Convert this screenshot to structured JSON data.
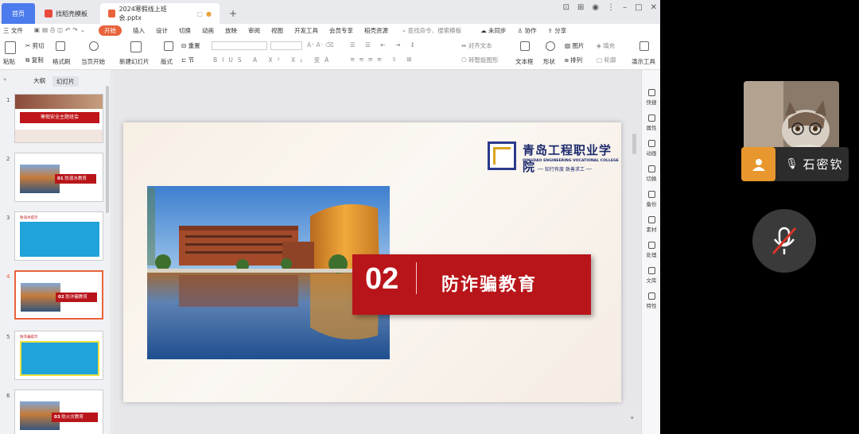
{
  "tabs": {
    "home": "首页",
    "template": "找稻壳模板",
    "document": "2024寒假线上班会.pptx"
  },
  "menu": {
    "file": "三 文件",
    "items": [
      "开始",
      "插入",
      "设计",
      "切换",
      "动画",
      "放映",
      "审阅",
      "视图",
      "开发工具",
      "会员专享",
      "稻壳资源"
    ],
    "search": "查找命令、搜索模板",
    "sync": "未同步",
    "collab": "协作",
    "share": "分享"
  },
  "ribbon": {
    "paste": "粘贴",
    "cut": "剪切",
    "copy": "复制",
    "format_painter": "格式刷",
    "play_from_current": "当页开始",
    "new_slide": "新建幻灯片",
    "layout": "版式",
    "section": "节",
    "reset": "重置",
    "align_text": "对齐文本",
    "smart_shape": "转智能图形",
    "textbox": "文本框",
    "shape": "形状",
    "picture": "图片",
    "fill": "填充",
    "arrange": "排列",
    "outline": "轮廓",
    "present_tools": "演示工具"
  },
  "left_pane": {
    "outline_tab": "大纲",
    "slides_tab": "幻灯片",
    "slides": [
      {
        "num": "1",
        "title": "寒假安全主题班会"
      },
      {
        "num": "2",
        "badge": "01",
        "label": "防溺水教育"
      },
      {
        "num": "3",
        "label": "防溺水提示"
      },
      {
        "num": "4",
        "badge": "02",
        "label": "防诈骗教育"
      },
      {
        "num": "5",
        "label": "防诈骗提示"
      },
      {
        "num": "6",
        "badge": "03",
        "label": "防火灾教育"
      }
    ]
  },
  "slide": {
    "college_cn": "青岛工程职业学院",
    "college_en": "QINGDAO ENGINEERING VOCATIONAL COLLEGE",
    "motto": "知行有度  致善求工",
    "section_number": "02",
    "section_title": "防诈骗教育"
  },
  "right_bar": [
    "快捷",
    "属性",
    "动画",
    "切换",
    "备份",
    "素材",
    "处理",
    "文库",
    "特性"
  ],
  "meeting": {
    "participant_name": "石密钦"
  },
  "colors": {
    "accent": "#e8633b",
    "slide_red": "#b8151a",
    "home_tab": "#4b7bec",
    "avatar": "#e8972e"
  }
}
